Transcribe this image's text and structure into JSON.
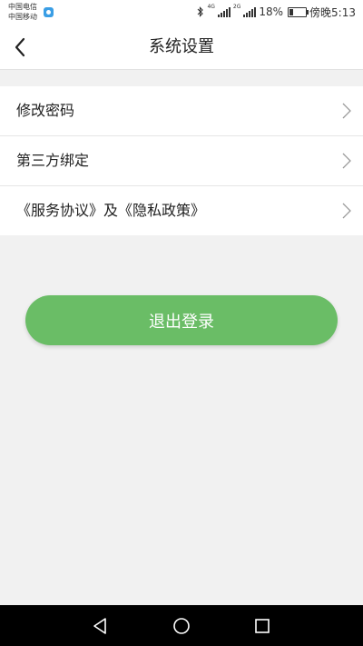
{
  "status_bar": {
    "carrier_1": "中国电信",
    "carrier_2": "中国移动",
    "net_1": "4G",
    "net_2": "2G",
    "battery": "18%",
    "time": "傍晚5:13",
    "icons": [
      "bluetooth-icon",
      "signal-icon",
      "battery-icon"
    ]
  },
  "header": {
    "title": "系统设置",
    "back_icon": "chevron-left-icon"
  },
  "menu": {
    "items": [
      {
        "label": "修改密码"
      },
      {
        "label": "第三方绑定"
      },
      {
        "label": "《服务协议》及《隐私政策》"
      }
    ],
    "item_icon": "chevron-right-icon"
  },
  "logout": {
    "label": "退出登录"
  },
  "nav_bar": {
    "icons": [
      "back-triangle-icon",
      "home-circle-icon",
      "recents-square-icon"
    ]
  },
  "colors": {
    "accent": "#6abd66",
    "background": "#f1f1f1",
    "surface": "#ffffff",
    "nav": "#000000"
  }
}
